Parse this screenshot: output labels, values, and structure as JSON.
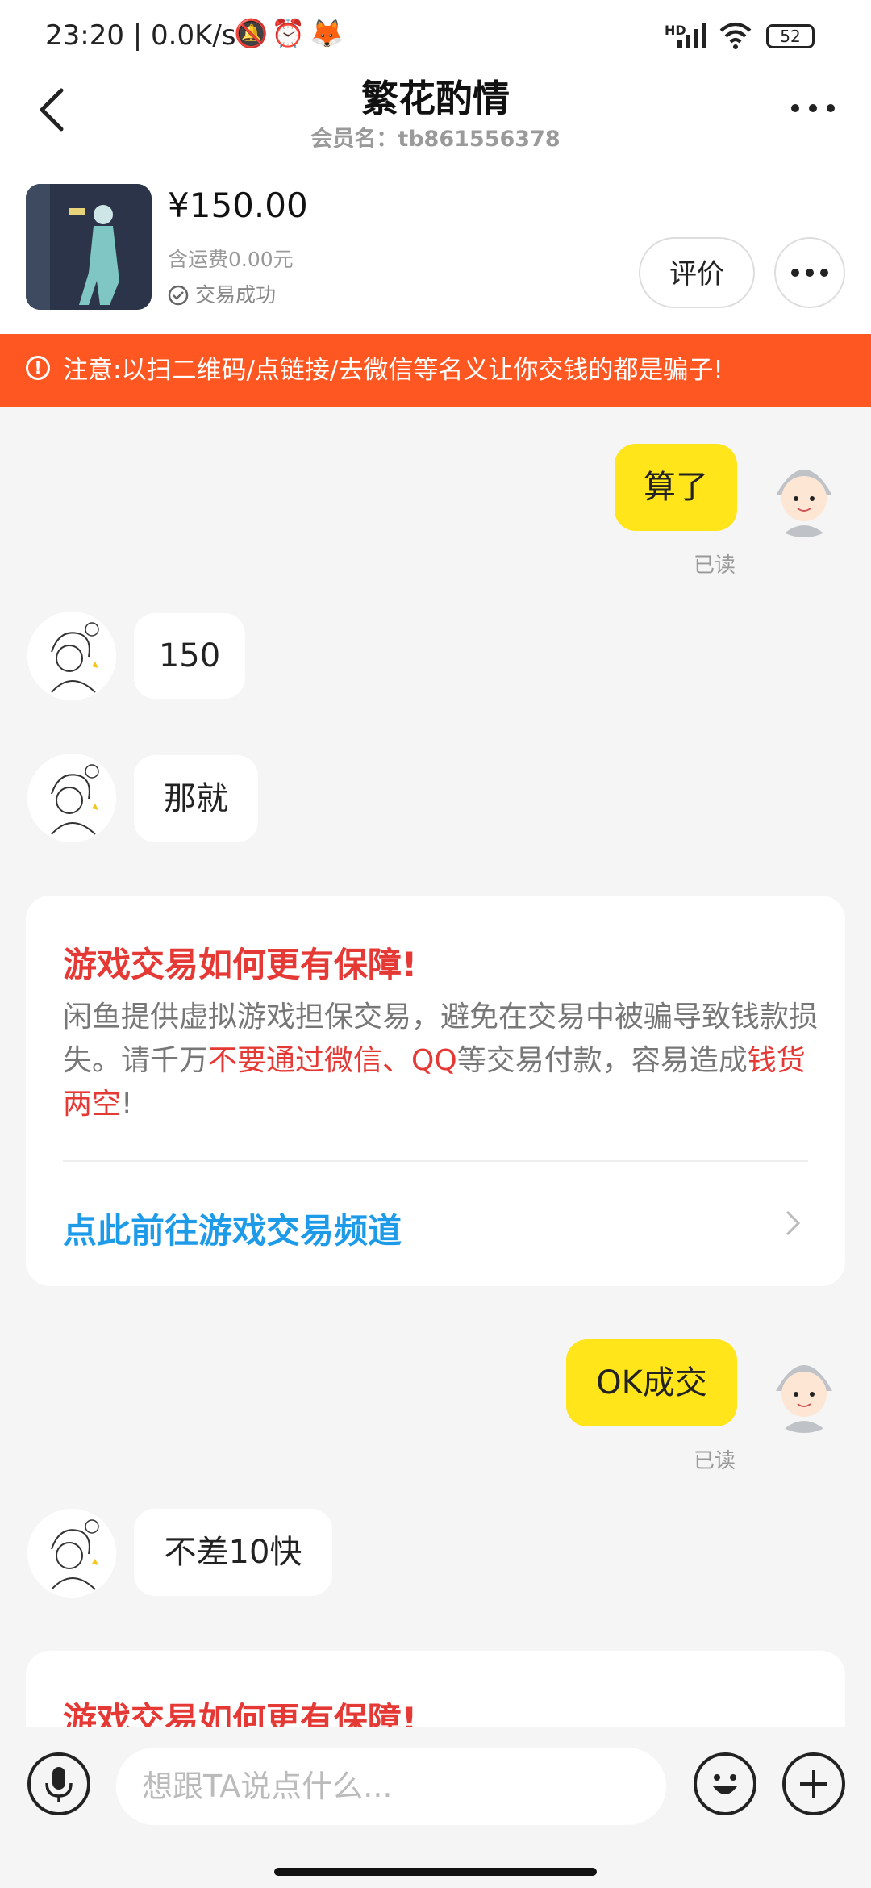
{
  "status_bar": {
    "time": "23:20 | 0.0K/s",
    "battery": "52",
    "network": "HD"
  },
  "header": {
    "title": "繁花酌情",
    "subtitle": "会员名：tb861556378"
  },
  "product": {
    "price": "¥150.00",
    "shipping": "含运费0.00元",
    "trade_status": "交易成功",
    "rate_label": "评价"
  },
  "warning": {
    "text": "注意:以扫二维码/点链接/去微信等名义让你交钱的都是骗子!"
  },
  "messages": [
    {
      "side": "me",
      "text": "算了",
      "read": "已读"
    },
    {
      "side": "other",
      "text": "150"
    },
    {
      "side": "other",
      "text": "那就"
    },
    {
      "side": "me",
      "text": "OK成交",
      "read": "已读"
    },
    {
      "side": "other",
      "text": "不差10快"
    }
  ],
  "notice_card": {
    "title": "游戏交易如何更有保障!",
    "body_1": "闲鱼提供虚拟游戏担保交易，避免在交易中被骗导致钱款损失。请千万",
    "body_red_1": "不要通过微信、QQ",
    "body_2": "等交易付款，容易造成",
    "body_red_2": "钱货两空",
    "body_3": "!",
    "link": "点此前往游戏交易频道"
  },
  "input": {
    "placeholder": "想跟TA说点什么..."
  },
  "colors": {
    "accent_yellow": "#ffe51a",
    "warning_orange": "#ff5722",
    "alert_red": "#e53935",
    "link_blue": "#1e9be8"
  }
}
